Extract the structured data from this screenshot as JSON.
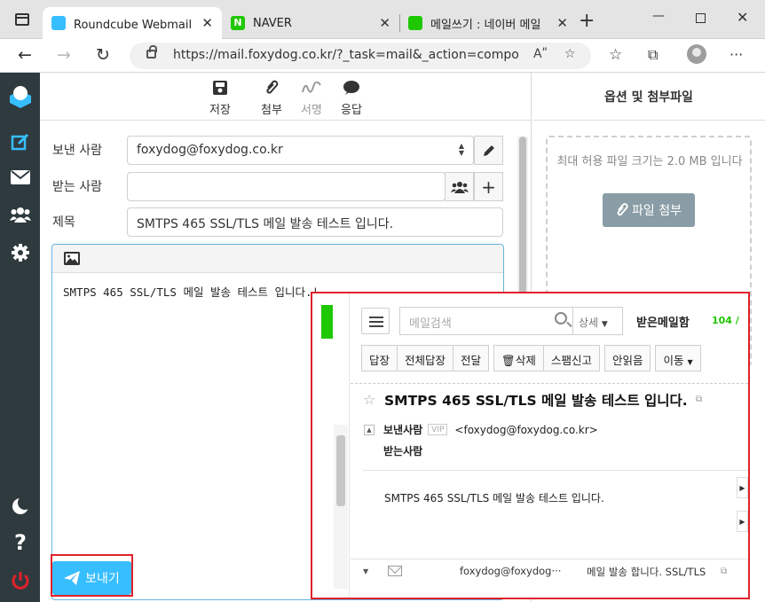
{
  "browser": {
    "tabs": [
      {
        "title": "Roundcube Webmail :: 쓰",
        "active": true
      },
      {
        "title": "NAVER",
        "active": false
      },
      {
        "title": "메일쓰기 : 네이버 메일",
        "active": false
      }
    ],
    "url": "https://mail.foxydog.co.kr/?_task=mail&_action=compose&_i..."
  },
  "compose": {
    "toolbar": {
      "save": "저장",
      "attach": "첨부",
      "signature": "서명",
      "response": "응답"
    },
    "from_label": "보낸 사람",
    "from_value": "foxydog@foxydog.co.kr",
    "to_label": "받는 사람",
    "to_value": "",
    "subject_label": "제목",
    "subject_value": "SMTPS 465 SSL/TLS 메일 발송 테스트 입니다.",
    "body": "SMTPS 465 SSL/TLS 메일 발송 테스트 입니다.|",
    "send_label": "보내기"
  },
  "options": {
    "title": "옵션 및 첨부파일",
    "max_size_text": "최대 허용 파일 크기는 2.0 MB 입니다",
    "attach_button": "파일 첨부"
  },
  "naver": {
    "search_placeholder": "메일검색",
    "detail": "상세",
    "inbox_title": "받은메일함",
    "inbox_count": "104 /",
    "buttons": [
      "답장",
      "전체답장",
      "전달",
      "삭제",
      "스팸신고",
      "안읽음",
      "이동"
    ],
    "subject": "SMTPS 465 SSL/TLS 메일 발송 테스트 입니다.",
    "from_label": "보낸사람",
    "vip": "VIP",
    "from_address": "<foxydog@foxydog.co.kr>",
    "to_label": "받는사람",
    "body": "SMTPS 465 SSL/TLS 메일 발송 테스트 입니다.",
    "list_sender": "foxydog@foxydog···",
    "list_subject": "메일 발송 합니다. SSL/TLS"
  },
  "colors": {
    "sidebar": "#2f3a3f",
    "accent": "#37beff",
    "highlight": "#e0212a",
    "naver_green": "#1ec800"
  }
}
